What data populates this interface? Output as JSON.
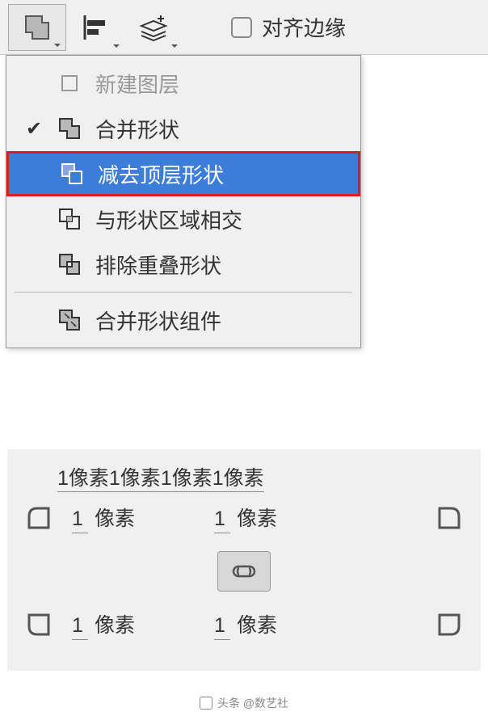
{
  "toolbar": {
    "align_edges_label": "对齐边缘"
  },
  "menu": {
    "items": [
      {
        "label": "新建图层",
        "disabled": true,
        "checked": false,
        "hasCheckbox": true
      },
      {
        "label": "合并形状",
        "disabled": false,
        "checked": true
      },
      {
        "label": "减去顶层形状",
        "disabled": false,
        "checked": false,
        "selected": true
      },
      {
        "label": "与形状区域相交",
        "disabled": false,
        "checked": false
      },
      {
        "label": "排除重叠形状",
        "disabled": false,
        "checked": false
      }
    ],
    "footer_item": {
      "label": "合并形状组件"
    }
  },
  "corner_panel": {
    "header_labels": [
      "1像素",
      "1像素",
      "1像素",
      "1像素"
    ],
    "top_left": {
      "value": "1",
      "unit": "像素"
    },
    "top_right": {
      "value": "1",
      "unit": "像素"
    },
    "bottom_left": {
      "value": "1",
      "unit": "像素"
    },
    "bottom_right": {
      "value": "1",
      "unit": "像素"
    }
  },
  "attribution": {
    "text": "头条 @数艺社"
  }
}
